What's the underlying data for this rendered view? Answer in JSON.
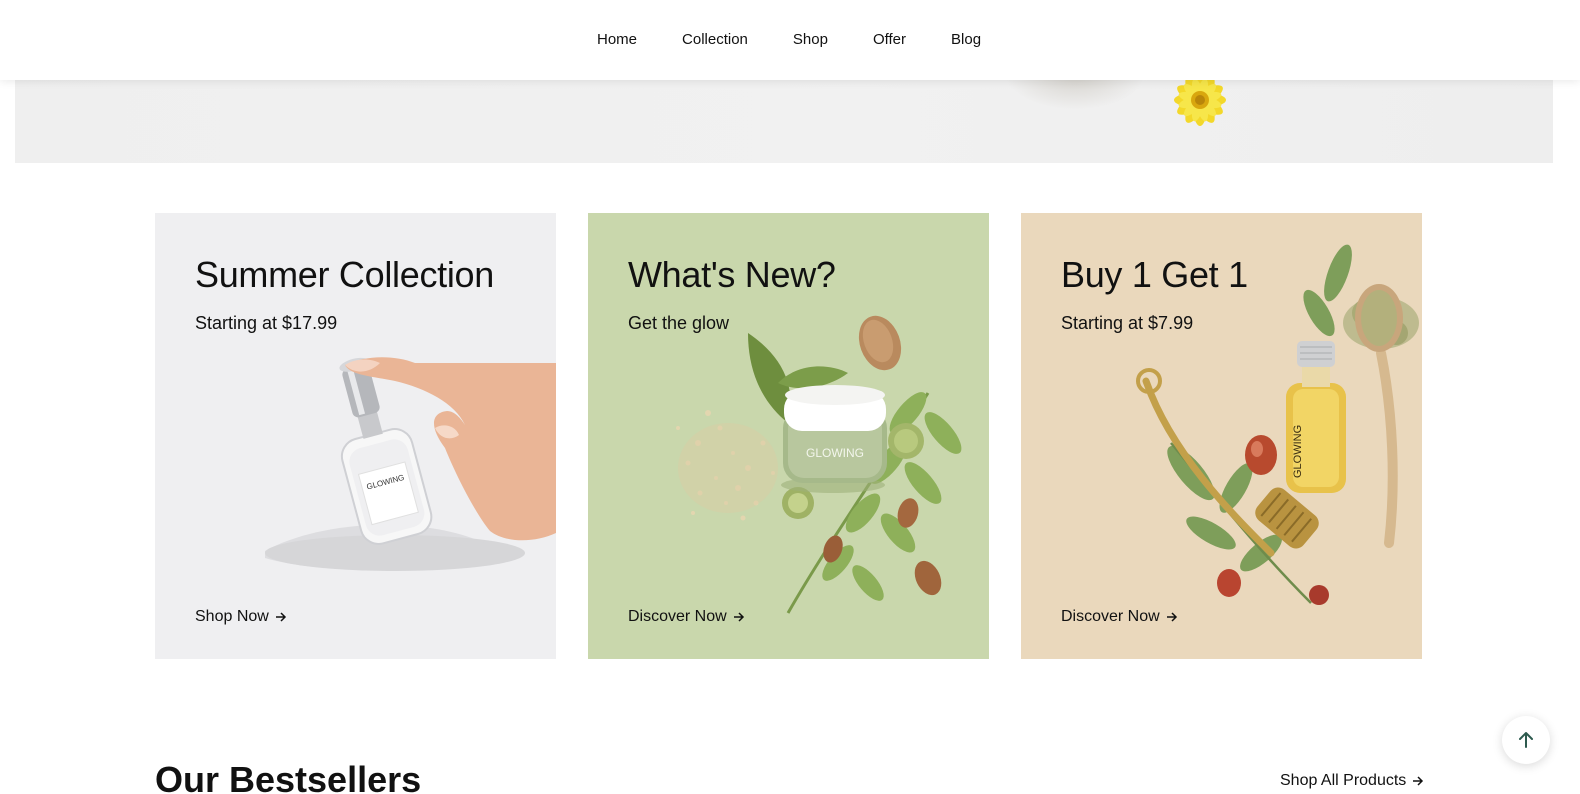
{
  "nav": {
    "items": [
      {
        "label": "Home"
      },
      {
        "label": "Collection"
      },
      {
        "label": "Shop"
      },
      {
        "label": "Offer"
      },
      {
        "label": "Blog"
      }
    ]
  },
  "cards": [
    {
      "title": "Summer Collection",
      "subtitle": "Starting at $17.99",
      "link": "Shop Now",
      "bg": "#efeff1",
      "product_label": "GLOWING"
    },
    {
      "title": "What's New?",
      "subtitle": "Get the glow",
      "link": "Discover Now",
      "bg": "#c9d7ac",
      "product_label": "GLOWING"
    },
    {
      "title": "Buy 1 Get 1",
      "subtitle": "Starting at $7.99",
      "link": "Discover Now",
      "bg": "#ead8bc",
      "product_label": "GLOWING"
    }
  ],
  "bestsellers": {
    "title": "Our Bestsellers",
    "shop_all": "Shop All Products"
  },
  "icons": {
    "arrow": "arrow-right-icon",
    "scroll_top": "arrow-up-icon"
  },
  "colors": {
    "accent_dark_green": "#2d5a4e",
    "text": "#111111"
  }
}
